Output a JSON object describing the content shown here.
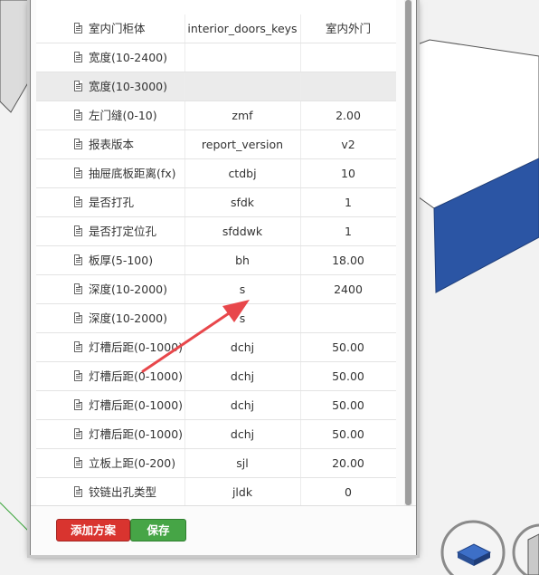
{
  "table": {
    "rows": [
      {
        "name": "室内门柜体",
        "key": "interior_doors_keys",
        "value": "室内外门",
        "selected": false
      },
      {
        "name": "宽度(10-2400)",
        "key": "",
        "value": "",
        "selected": false
      },
      {
        "name": "宽度(10-3000)",
        "key": "",
        "value": "",
        "selected": true
      },
      {
        "name": "左门缝(0-10)",
        "key": "zmf",
        "value": "2.00",
        "selected": false
      },
      {
        "name": "报表版本",
        "key": "report_version",
        "value": "v2",
        "selected": false
      },
      {
        "name": "抽屉底板距离(fx)",
        "key": "ctdbj",
        "value": "10",
        "selected": false
      },
      {
        "name": "是否打孔",
        "key": "sfdk",
        "value": "1",
        "selected": false
      },
      {
        "name": "是否打定位孔",
        "key": "sfddwk",
        "value": "1",
        "selected": false
      },
      {
        "name": "板厚(5-100)",
        "key": "bh",
        "value": "18.00",
        "selected": false
      },
      {
        "name": "深度(10-2000)",
        "key": "s",
        "value": "2400",
        "selected": false
      },
      {
        "name": "深度(10-2000)",
        "key": "s",
        "value": "",
        "selected": false
      },
      {
        "name": "灯槽后距(0-1000)",
        "key": "dchj",
        "value": "50.00",
        "selected": false
      },
      {
        "name": "灯槽后距(0-1000)",
        "key": "dchj",
        "value": "50.00",
        "selected": false
      },
      {
        "name": "灯槽后距(0-1000)",
        "key": "dchj",
        "value": "50.00",
        "selected": false
      },
      {
        "name": "灯槽后距(0-1000)",
        "key": "dchj",
        "value": "50.00",
        "selected": false
      },
      {
        "name": "立板上距(0-200)",
        "key": "sjl",
        "value": "20.00",
        "selected": false
      },
      {
        "name": "铰链出孔类型",
        "key": "jldk",
        "value": "0",
        "selected": false
      }
    ]
  },
  "footer": {
    "add_scheme_label": "添加方案",
    "save_label": "保存"
  },
  "colors": {
    "add_button": "#d9342f",
    "save_button": "#46a546",
    "annotation_arrow": "#e8474b",
    "box_blue": "#2b55a4"
  },
  "icons": [
    "document-icon",
    "annotation-arrow",
    "view-cube-icon"
  ]
}
